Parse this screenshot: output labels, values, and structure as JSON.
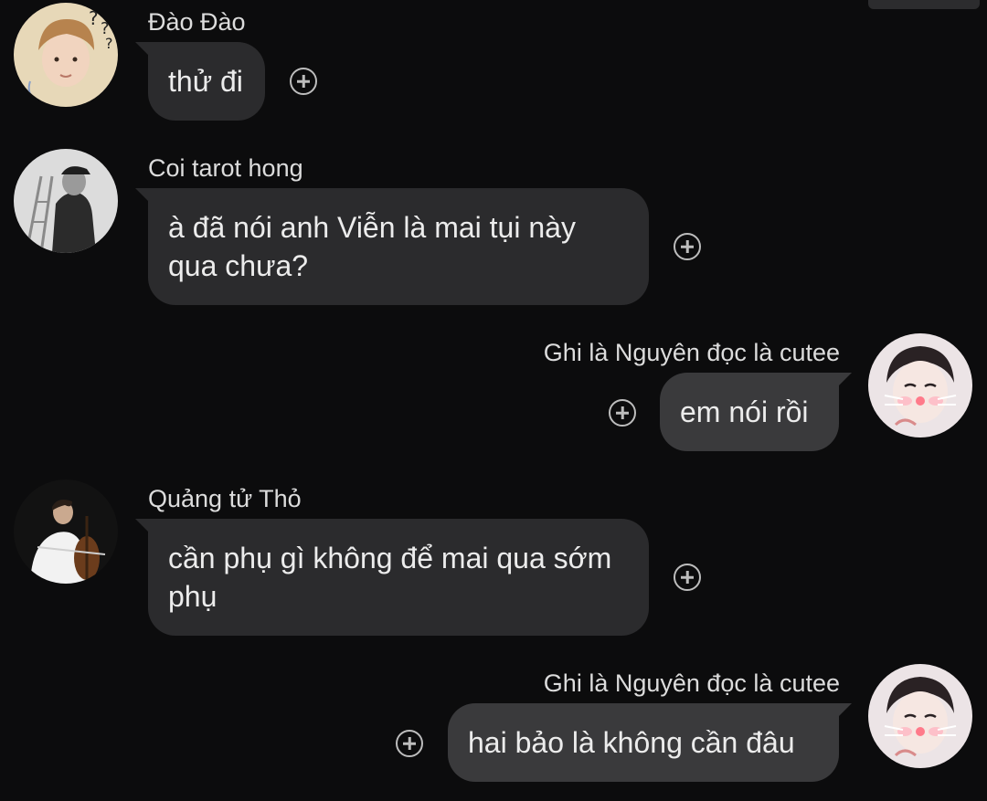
{
  "messages": [
    {
      "sender": "Đào Đào",
      "text": "thử đi",
      "direction": "incoming",
      "avatar": "avatar-boy-question-marks",
      "reaction_icon": "add-reaction-icon"
    },
    {
      "sender": "Coi tarot hong",
      "text": "à đã nói anh Viễn là mai tụi này qua chưa?",
      "direction": "incoming",
      "avatar": "avatar-man-cap-grayscale",
      "reaction_icon": "add-reaction-icon"
    },
    {
      "sender": "Ghi là Nguyên đọc là cutee",
      "text": "em nói rồi",
      "direction": "outgoing",
      "avatar": "avatar-cat-filter",
      "reaction_icon": "add-reaction-icon"
    },
    {
      "sender": "Quảng tử Thỏ",
      "text": "cần phụ gì không để mai qua sớm phụ",
      "direction": "incoming",
      "avatar": "avatar-cellist",
      "reaction_icon": "add-reaction-icon"
    },
    {
      "sender": "Ghi là Nguyên đọc là cutee",
      "text": "hai bảo là không cần đâu",
      "direction": "outgoing",
      "avatar": "avatar-cat-filter",
      "reaction_icon": "add-reaction-icon"
    }
  ],
  "colors": {
    "background": "#0c0c0d",
    "incoming_bubble": "#2b2b2d",
    "outgoing_bubble": "#3a3a3c",
    "text": "#ececec",
    "sender_name": "#dcdcdc"
  }
}
